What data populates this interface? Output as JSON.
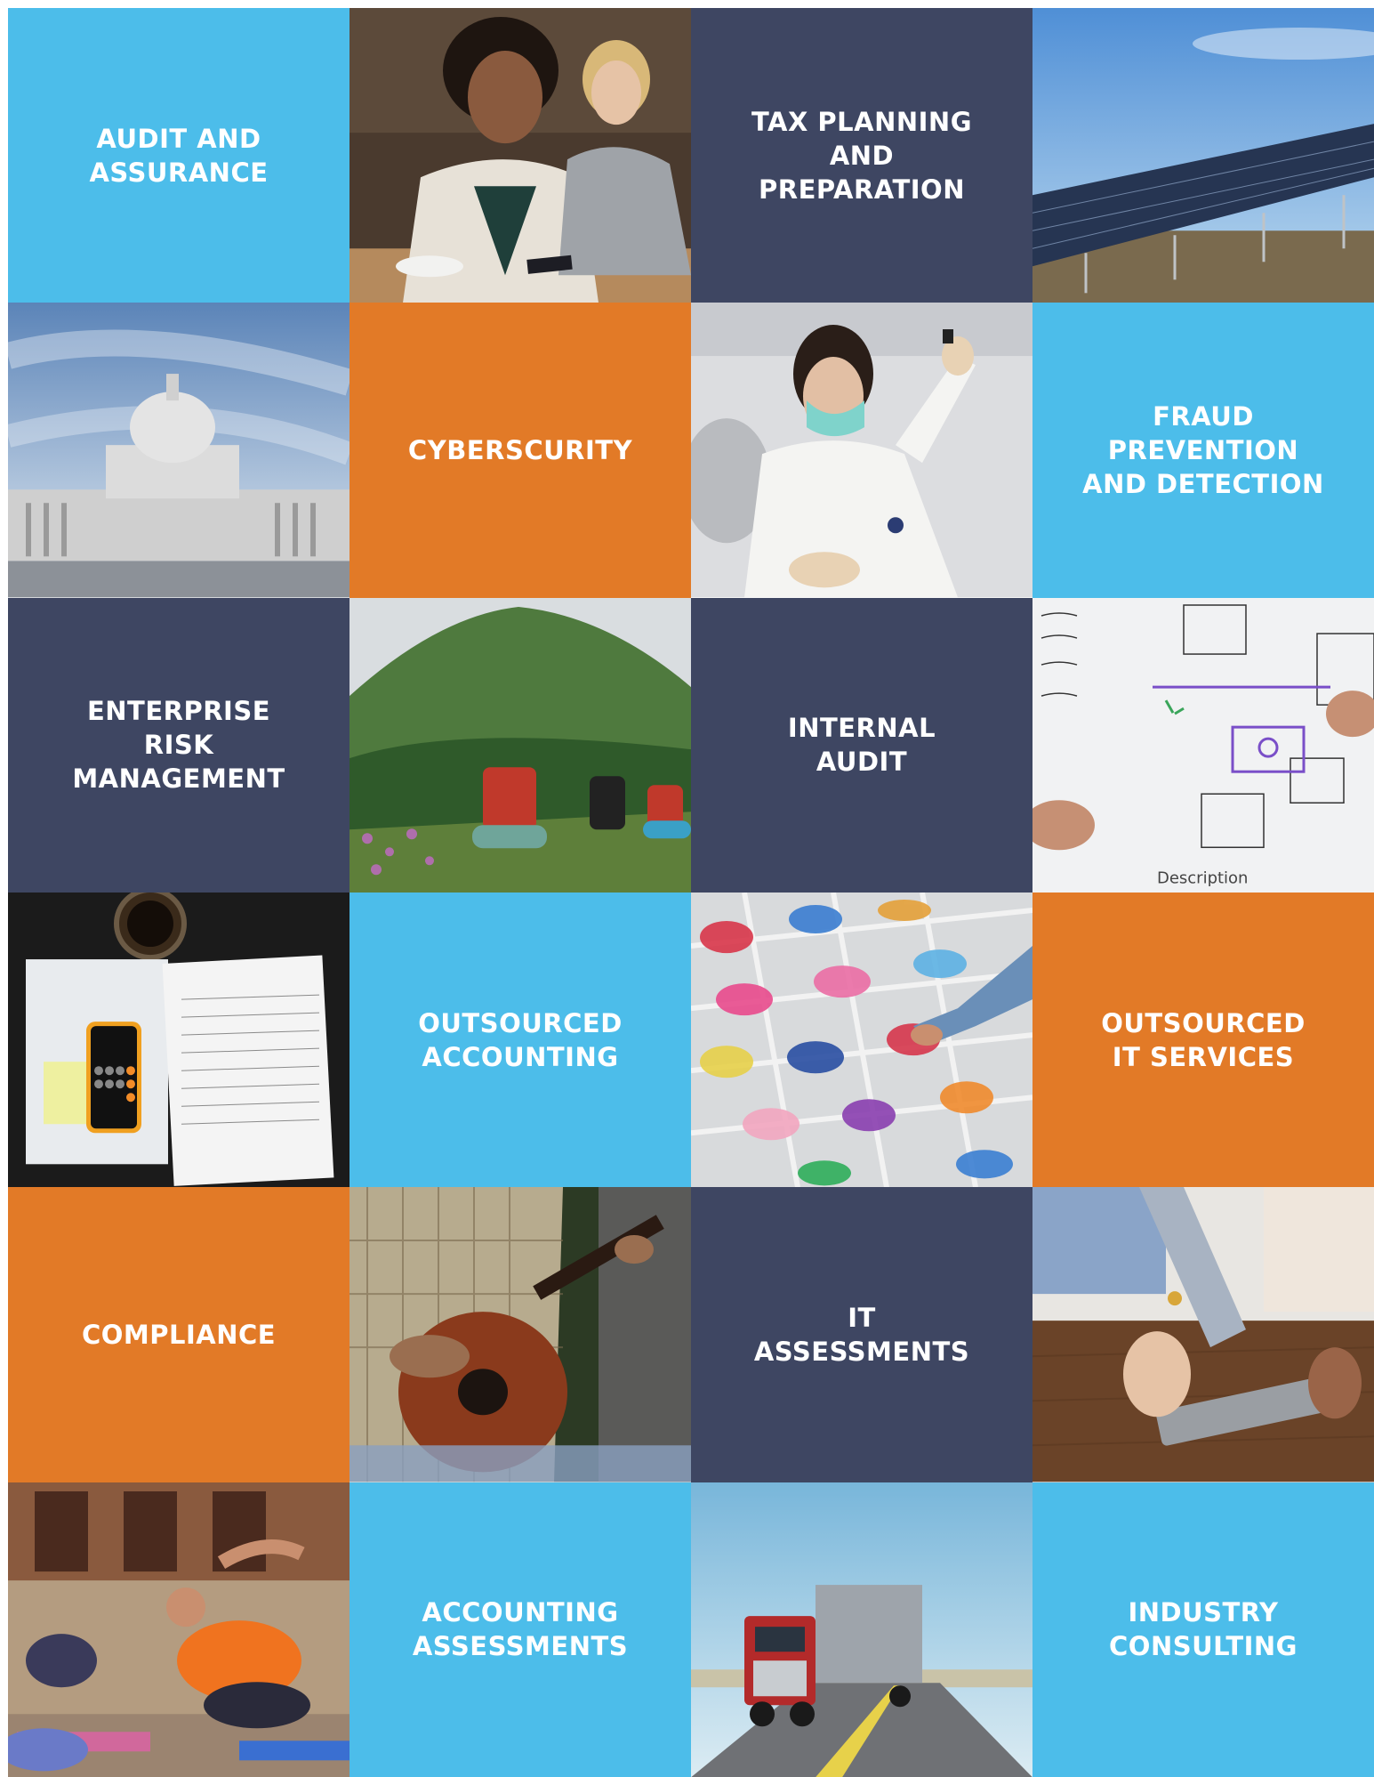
{
  "services": {
    "audit_assurance": "AUDIT AND\nASSURANCE",
    "tax_planning": "TAX PLANNING\nAND\nPREPARATION",
    "cybersecurity": "CYBERSCURITY",
    "fraud": "FRAUD\nPREVENTION\nAND DETECTION",
    "erm": "ENTERPRISE\nRISK\nMANAGEMENT",
    "internal_audit": "INTERNAL\nAUDIT",
    "outsourced_accounting": "OUTSOURCED\nACCOUNTING",
    "outsourced_it": "OUTSOURCED\nIT SERVICES",
    "compliance": "COMPLIANCE",
    "it_assessments": "IT\nASSESSMENTS",
    "accounting_assessments": "ACCOUNTING\nASSESSMENTS",
    "industry_consulting": "INDUSTRY\nCONSULTING"
  },
  "colors": {
    "sky": "#4cbdea",
    "navy": "#3e4662",
    "orange": "#e27a27"
  },
  "photos": [
    "laughing-businesswomen-photo",
    "solar-panels-photo",
    "capitol-building-photo",
    "lab-scientist-photo",
    "mountain-hikers-photo",
    "whiteboard-planning-photo",
    "tax-forms-calculator-photo",
    "candy-bins-photo",
    "guitar-player-photo",
    "tablet-meeting-photo",
    "yoga-class-photo",
    "semi-truck-highway-photo"
  ]
}
